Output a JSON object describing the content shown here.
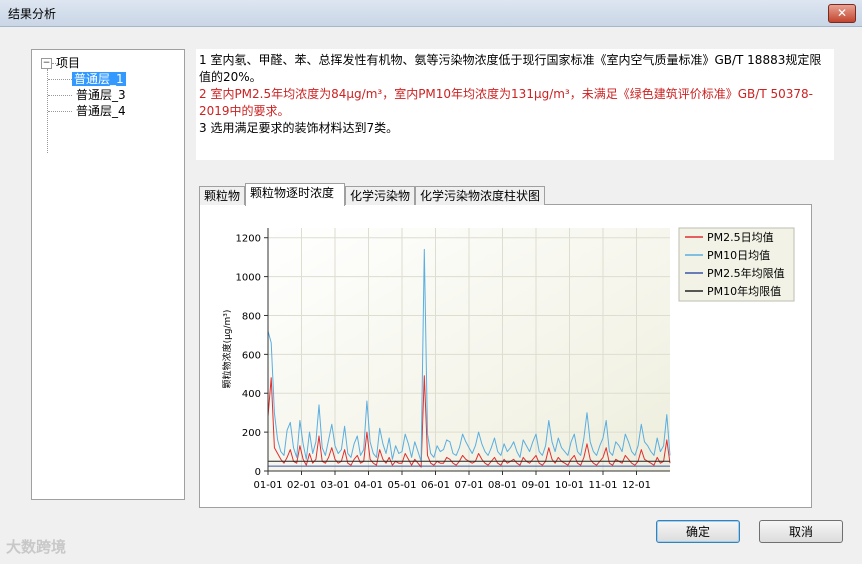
{
  "window": {
    "title": "结果分析",
    "close_label": "✕"
  },
  "tree": {
    "root": "项目",
    "expander": "−",
    "items": [
      {
        "label": "普通层_1",
        "selected": true
      },
      {
        "label": "普通层_3",
        "selected": false
      },
      {
        "label": "普通层_4",
        "selected": false
      }
    ]
  },
  "results": {
    "line1": "1 室内氡、甲醛、苯、总挥发性有机物、氨等污染物浓度低于现行国家标准《室内空气质量标准》GB/T 18883规定限值的20%。",
    "line2": "2 室内PM2.5年均浓度为84μg/m³，室内PM10年均浓度为131μg/m³，未满足《绿色建筑评价标准》GB/T 50378-2019中的要求。",
    "line3": "3 选用满足要求的装饰材料达到7类。"
  },
  "tabs": [
    {
      "label": "颗粒物"
    },
    {
      "label": "颗粒物逐时浓度"
    },
    {
      "label": "化学污染物"
    },
    {
      "label": "化学污染物浓度柱状图"
    }
  ],
  "buttons": {
    "ok": "确定",
    "cancel": "取消"
  },
  "watermark": "大数跨境",
  "chart_data": {
    "type": "line",
    "ylabel": "颗粒物浓度(μg/m³)",
    "xlabel": "",
    "ylim": [
      0,
      1250
    ],
    "yticks": [
      "0",
      "200",
      "400",
      "600",
      "800",
      "1000",
      "1200"
    ],
    "xticks": [
      "01-01",
      "02-01",
      "03-01",
      "04-01",
      "05-01",
      "06-01",
      "07-01",
      "08-01",
      "09-01",
      "10-01",
      "11-01",
      "12-01"
    ],
    "legend_position": "top-right",
    "grid": true,
    "series": [
      {
        "name": "PM2.5日均值",
        "color": "#e03030",
        "values": [
          280,
          480,
          120,
          90,
          60,
          40,
          70,
          110,
          50,
          40,
          130,
          60,
          30,
          90,
          40,
          60,
          180,
          50,
          40,
          70,
          120,
          60,
          40,
          50,
          110,
          40,
          30,
          60,
          80,
          40,
          50,
          200,
          60,
          40,
          30,
          110,
          60,
          40,
          70,
          30,
          50,
          40,
          40,
          90,
          60,
          30,
          60,
          40,
          20,
          490,
          80,
          40,
          30,
          50,
          40,
          40,
          70,
          60,
          40,
          30,
          50,
          80,
          60,
          50,
          40,
          50,
          90,
          60,
          40,
          30,
          50,
          70,
          40,
          30,
          60,
          40,
          50,
          60,
          40,
          30,
          70,
          50,
          40,
          60,
          80,
          40,
          30,
          50,
          120,
          60,
          40,
          70,
          50,
          40,
          30,
          60,
          80,
          40,
          30,
          70,
          140,
          60,
          40,
          30,
          50,
          70,
          120,
          40,
          30,
          60,
          50,
          40,
          80,
          60,
          40,
          30,
          50,
          110,
          60,
          50,
          40,
          30,
          70,
          40,
          50,
          160,
          40
        ]
      },
      {
        "name": "PM10日均值",
        "color": "#5aaee0",
        "values": [
          720,
          660,
          300,
          160,
          100,
          80,
          210,
          250,
          120,
          70,
          260,
          140,
          60,
          200,
          90,
          150,
          340,
          120,
          80,
          160,
          240,
          130,
          90,
          110,
          230,
          90,
          70,
          140,
          180,
          80,
          110,
          360,
          150,
          90,
          70,
          220,
          140,
          90,
          170,
          60,
          130,
          90,
          100,
          190,
          140,
          70,
          150,
          100,
          50,
          1140,
          190,
          90,
          70,
          130,
          100,
          110,
          160,
          150,
          90,
          80,
          120,
          190,
          150,
          120,
          90,
          130,
          200,
          140,
          100,
          80,
          120,
          170,
          100,
          80,
          140,
          100,
          120,
          150,
          100,
          70,
          160,
          130,
          100,
          150,
          190,
          100,
          80,
          130,
          260,
          150,
          100,
          170,
          120,
          100,
          80,
          150,
          190,
          100,
          80,
          170,
          300,
          150,
          100,
          80,
          130,
          170,
          260,
          100,
          80,
          150,
          130,
          100,
          190,
          150,
          100,
          80,
          130,
          240,
          150,
          130,
          100,
          80,
          170,
          100,
          130,
          290,
          80
        ]
      },
      {
        "name": "PM2.5年均限值",
        "color": "#3a55a8",
        "values": [
          25
        ]
      },
      {
        "name": "PM10年均限值",
        "color": "#222222",
        "values": [
          50
        ]
      }
    ]
  }
}
